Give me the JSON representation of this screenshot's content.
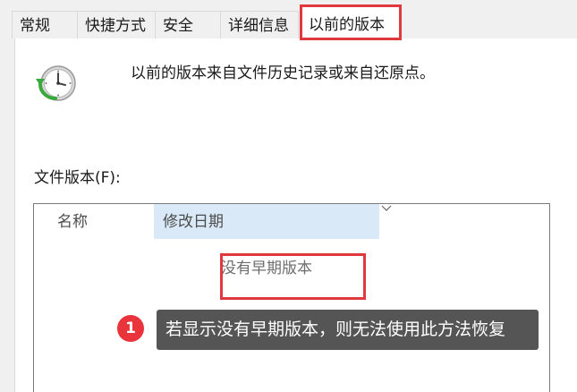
{
  "tabs": [
    {
      "label": "常规"
    },
    {
      "label": "快捷方式"
    },
    {
      "label": "安全"
    },
    {
      "label": "详细信息"
    },
    {
      "label": "以前的版本",
      "active": true
    }
  ],
  "header": {
    "icon": "history-clock-icon",
    "description": "以前的版本来自文件历史记录或来自还原点。"
  },
  "file_versions": {
    "label": "文件版本(F):",
    "columns": [
      {
        "label": "名称"
      },
      {
        "label": "修改日期",
        "sorted": true
      }
    ],
    "empty_message": "没有早期版本"
  },
  "annotation": {
    "number": "1",
    "text": "若显示没有早期版本，则无法使用此方法恢复"
  },
  "colors": {
    "highlight": "#e0383e",
    "sorted_column": "#d9e9f7",
    "tooltip_bg": "#555555"
  }
}
